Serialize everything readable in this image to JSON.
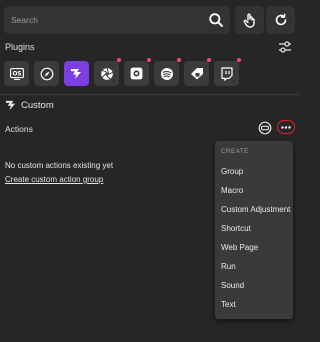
{
  "search": {
    "placeholder": "Search"
  },
  "plugins": {
    "title": "Plugins",
    "items": [
      {
        "icon": "os-icon",
        "label": "OS",
        "dot": false,
        "active": false
      },
      {
        "icon": "compass-icon",
        "dot": false,
        "active": false
      },
      {
        "icon": "custom-bolt-icon",
        "dot": false,
        "active": true
      },
      {
        "icon": "aperture-icon",
        "dot": true,
        "active": false
      },
      {
        "icon": "camera-square-icon",
        "dot": true,
        "active": false
      },
      {
        "icon": "spotify-icon",
        "dot": true,
        "active": false
      },
      {
        "icon": "tag-icon",
        "dot": true,
        "active": false
      },
      {
        "icon": "twitch-icon",
        "dot": true,
        "active": false
      }
    ]
  },
  "custom": {
    "title": "Custom",
    "actions_title": "Actions",
    "empty_text": "No custom actions existing yet",
    "create_link": "Create custom action group"
  },
  "menu": {
    "header": "CREATE",
    "items": [
      "Group",
      "Macro",
      "Custom Adjustment",
      "Shortcut",
      "Web Page",
      "Run",
      "Sound",
      "Text"
    ]
  },
  "colors": {
    "background": "#262626",
    "accent": "#7b3fe4",
    "notification_dot": "#f04a6b",
    "highlight_ring": "#e02222"
  }
}
